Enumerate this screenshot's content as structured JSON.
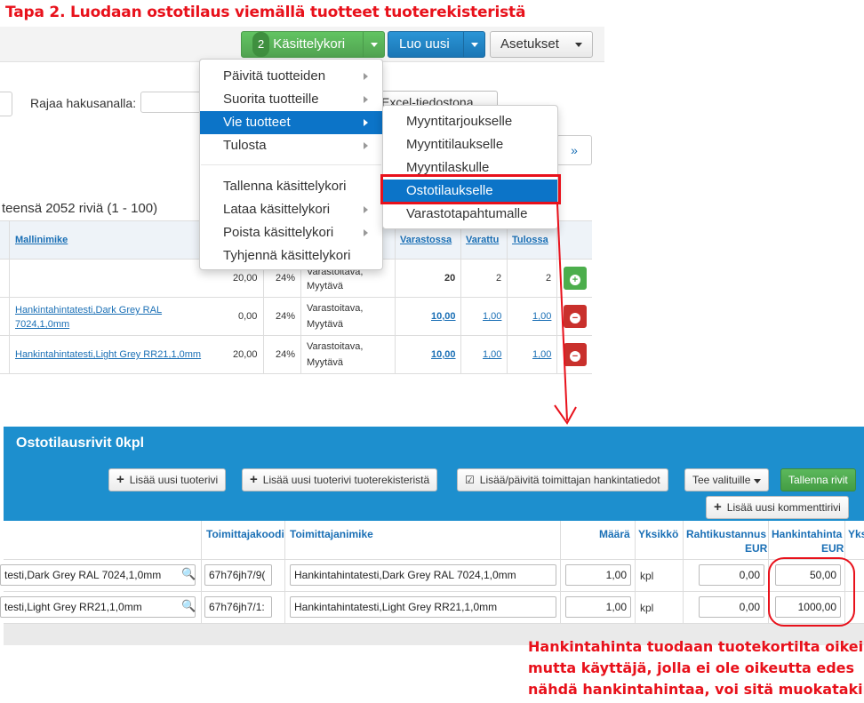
{
  "step_title": "Tapa 2. Luodaan ostotilaus viemällä tuotteet tuoterekisteristä",
  "toolbar": {
    "basket_count": "2",
    "basket_label": "Käsittelykori",
    "new_label": "Luo uusi",
    "settings_label": "Asetukset"
  },
  "filter": {
    "search_label": "Rajaa hakusanalla:",
    "excel_label": "Excel-tiedostona",
    "pager_next": "»"
  },
  "grid": {
    "total_text": "teensä 2052 riviä (1 - 100)",
    "headers": {
      "model": "Mallinimike",
      "stock": "Varastossa",
      "reserved": "Varattu",
      "incoming": "Tulossa"
    },
    "rows": [
      {
        "name": "",
        "price": "20,00",
        "vat": "24%",
        "status1": "Varastoitava,",
        "status2": "Myytävä",
        "stock": "20",
        "reserved": "2",
        "incoming": "2"
      },
      {
        "name": "Hankintahintatesti,Dark Grey RAL 7024,1,0mm",
        "price": "0,00",
        "vat": "24%",
        "status1": "Varastoitava,",
        "status2": "Myytävä",
        "stock": "10,00",
        "reserved": "1,00",
        "incoming": "1,00"
      },
      {
        "name": "Hankintahintatesti,Light Grey RR21,1,0mm",
        "price": "20,00",
        "vat": "24%",
        "status1": "Varastoitava,",
        "status2": "Myytävä",
        "stock": "10,00",
        "reserved": "1,00",
        "incoming": "1,00"
      }
    ]
  },
  "menu_main": {
    "items": [
      "Päivitä tuotteiden",
      "Suorita tuotteille",
      "Vie tuotteet",
      "Tulosta",
      "Tallenna käsittelykori",
      "Lataa käsittelykori",
      "Poista käsittelykori",
      "Tyhjennä käsittelykori"
    ]
  },
  "menu_sub": {
    "items": [
      "Myyntitarjoukselle",
      "Myyntitilaukselle",
      "Myyntilaskulle",
      "Ostotilaukselle",
      "Varastotapahtumalle"
    ]
  },
  "panel": {
    "title": "Ostotilausrivit 0kpl",
    "buttons": {
      "add_row": "Lisää uusi tuoterivi",
      "add_from_registry": "Lisää uusi tuoterivi tuoterekisteristä",
      "update_supplier": "Lisää/päivitä toimittajan hankintatiedot",
      "for_selected": "Tee valituille",
      "save_rows": "Tallenna rivit",
      "add_comment": "Lisää uusi kommenttirivi"
    },
    "headers": {
      "supplier_code": "Toimittajakoodi",
      "supplier_name": "Toimittajanimike",
      "qty": "Määrä",
      "unit": "Yksikkö",
      "freight": "Rahtikustannus",
      "freight_cur": "EUR",
      "purchase": "Hankintahinta",
      "purchase_cur": "EUR",
      "unit_price_partial": "Yks"
    },
    "rows": [
      {
        "product": "testi,Dark Grey RAL 7024,1,0mm",
        "code": "67h76jh7/9(",
        "name": "Hankintahintatesti,Dark Grey RAL 7024,1,0mm",
        "qty": "1,00",
        "unit": "kpl",
        "freight": "0,00",
        "purchase": "50,00"
      },
      {
        "product": "testi,Light Grey RR21,1,0mm",
        "code": "67h76jh7/1:",
        "name": "Hankintahintatesti,Light Grey RR21,1,0mm",
        "qty": "1,00",
        "unit": "kpl",
        "freight": "0,00",
        "purchase": "1000,00"
      }
    ]
  },
  "note_lines": [
    "Hankintahinta tuodaan tuotekortilta oikein,",
    "mutta käyttäjä, jolla ei ole oikeutta edes",
    "nähdä hankintahintaa, voi sitä muokatakin"
  ],
  "colors": {
    "annotation_red": "#e8111b",
    "menu_active": "#0c74c8",
    "panel_blue": "#1d8fce"
  }
}
